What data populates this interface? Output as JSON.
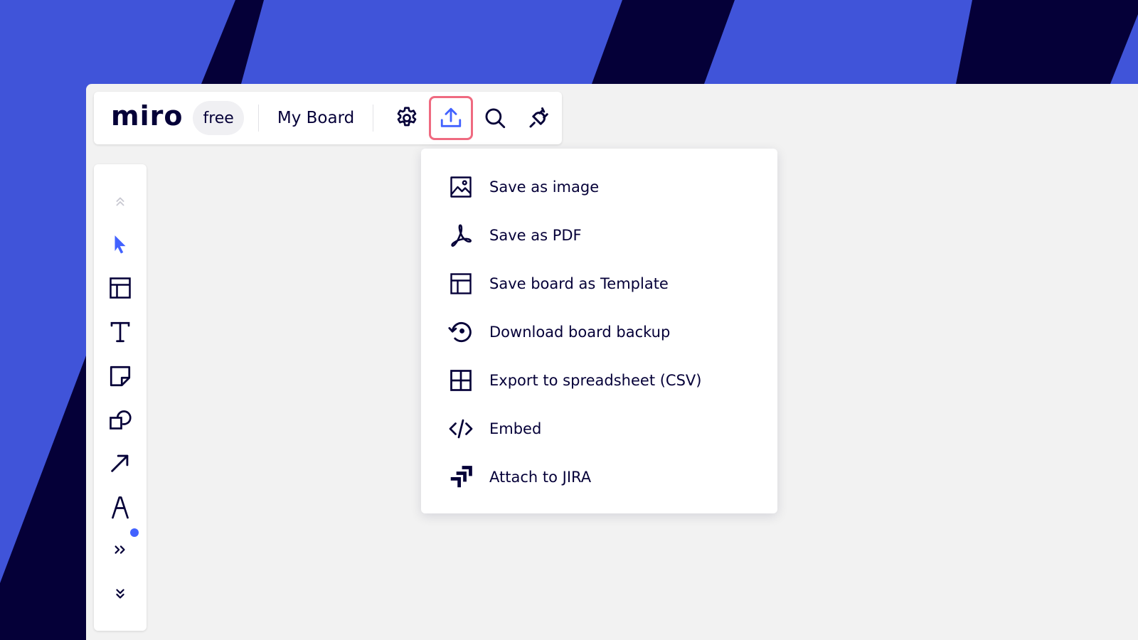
{
  "colors": {
    "brand_blue": "#4054d9",
    "stripe_dark": "#050038",
    "ink": "#050038",
    "accent": "#4262ff",
    "highlight": "#ef6a80",
    "canvas": "#f2f2f2"
  },
  "topbar": {
    "logo": "miro",
    "plan": "free",
    "board_name": "My Board",
    "buttons": [
      {
        "name": "settings",
        "icon": "gear-icon"
      },
      {
        "name": "export",
        "icon": "upload-icon",
        "active": true
      },
      {
        "name": "search",
        "icon": "search-icon"
      },
      {
        "name": "integrations",
        "icon": "plug-icon"
      }
    ]
  },
  "toolbar": {
    "tools": [
      {
        "name": "collapse-up",
        "icon": "chevrons-up-icon"
      },
      {
        "name": "select",
        "icon": "cursor-icon",
        "active": true
      },
      {
        "name": "templates",
        "icon": "layout-icon"
      },
      {
        "name": "text",
        "icon": "text-icon"
      },
      {
        "name": "sticky-note",
        "icon": "sticky-note-icon"
      },
      {
        "name": "shapes",
        "icon": "shapes-icon"
      },
      {
        "name": "connection-line",
        "icon": "arrow-icon"
      },
      {
        "name": "pen",
        "icon": "pen-icon"
      },
      {
        "name": "more-apps",
        "icon": "chevrons-right-icon",
        "badge": true
      },
      {
        "name": "collapse-down",
        "icon": "chevrons-down-icon"
      }
    ]
  },
  "export_menu": {
    "items": [
      {
        "label": "Save as image",
        "icon": "image-icon"
      },
      {
        "label": "Save as PDF",
        "icon": "pdf-icon"
      },
      {
        "label": "Save board as Template",
        "icon": "template-icon"
      },
      {
        "label": "Download board backup",
        "icon": "backup-icon"
      },
      {
        "label": "Export to spreadsheet (CSV)",
        "icon": "grid-icon"
      },
      {
        "label": "Embed",
        "icon": "code-icon"
      },
      {
        "label": "Attach to JIRA",
        "icon": "jira-icon"
      }
    ]
  }
}
